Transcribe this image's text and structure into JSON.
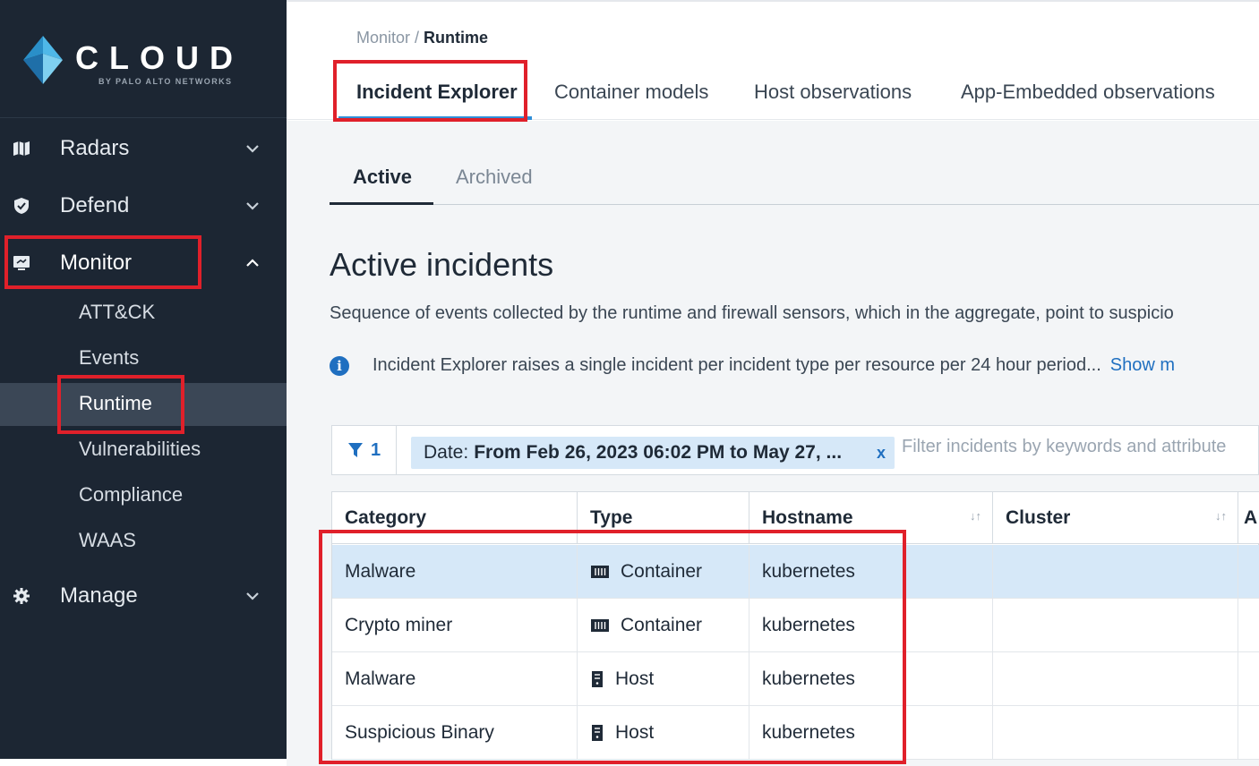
{
  "brand": {
    "name": "CLOUD",
    "tagline": "BY PALO ALTO NETWORKS"
  },
  "sidebar": {
    "items": [
      {
        "label": "Radars",
        "icon": "map-icon",
        "expanded": false
      },
      {
        "label": "Defend",
        "icon": "shield-icon",
        "expanded": false
      },
      {
        "label": "Monitor",
        "icon": "monitor-icon",
        "expanded": true
      },
      {
        "label": "Manage",
        "icon": "gear-icon",
        "expanded": false
      }
    ],
    "monitor_children": [
      {
        "label": "ATT&CK"
      },
      {
        "label": "Events"
      },
      {
        "label": "Runtime",
        "active": true
      },
      {
        "label": "Vulnerabilities"
      },
      {
        "label": "Compliance"
      },
      {
        "label": "WAAS"
      }
    ],
    "collapse_glyph": "‹"
  },
  "breadcrumb": {
    "parent": "Monitor",
    "separator": " / ",
    "current": "Runtime"
  },
  "tabs": [
    {
      "label": "Incident Explorer",
      "active": true
    },
    {
      "label": "Container models"
    },
    {
      "label": "Host observations"
    },
    {
      "label": "App-Embedded observations"
    }
  ],
  "subtabs": [
    {
      "label": "Active",
      "active": true
    },
    {
      "label": "Archived"
    }
  ],
  "page": {
    "title": "Active incidents",
    "description": "Sequence of events collected by the runtime and firewall sensors, which in the aggregate, point to suspicio",
    "info_text": "Incident Explorer raises a single incident per incident type per resource per 24 hour period...",
    "info_link": "Show m"
  },
  "filter": {
    "count": "1",
    "chip_label": "Date:",
    "chip_value": "From Feb 26, 2023 06:02 PM to May 27, ...",
    "chip_remove": "x",
    "placeholder": "Filter incidents by keywords and attribute"
  },
  "table": {
    "columns": [
      "Category",
      "Type",
      "Hostname",
      "Cluster",
      "A"
    ],
    "rows": [
      {
        "category": "Malware",
        "type": "Container",
        "type_icon": "container-icon",
        "hostname": "kubernetes",
        "cluster": "",
        "selected": true
      },
      {
        "category": "Crypto miner",
        "type": "Container",
        "type_icon": "container-icon",
        "hostname": "kubernetes",
        "cluster": ""
      },
      {
        "category": "Malware",
        "type": "Host",
        "type_icon": "host-icon",
        "hostname": "kubernetes",
        "cluster": ""
      },
      {
        "category": "Suspicious Binary",
        "type": "Host",
        "type_icon": "host-icon",
        "hostname": "kubernetes",
        "cluster": ""
      }
    ]
  },
  "colors": {
    "sidebar_bg": "#1c2633",
    "accent": "#2f8fd8",
    "highlight": "#e0202a",
    "selected_row": "#d6e8f8"
  }
}
